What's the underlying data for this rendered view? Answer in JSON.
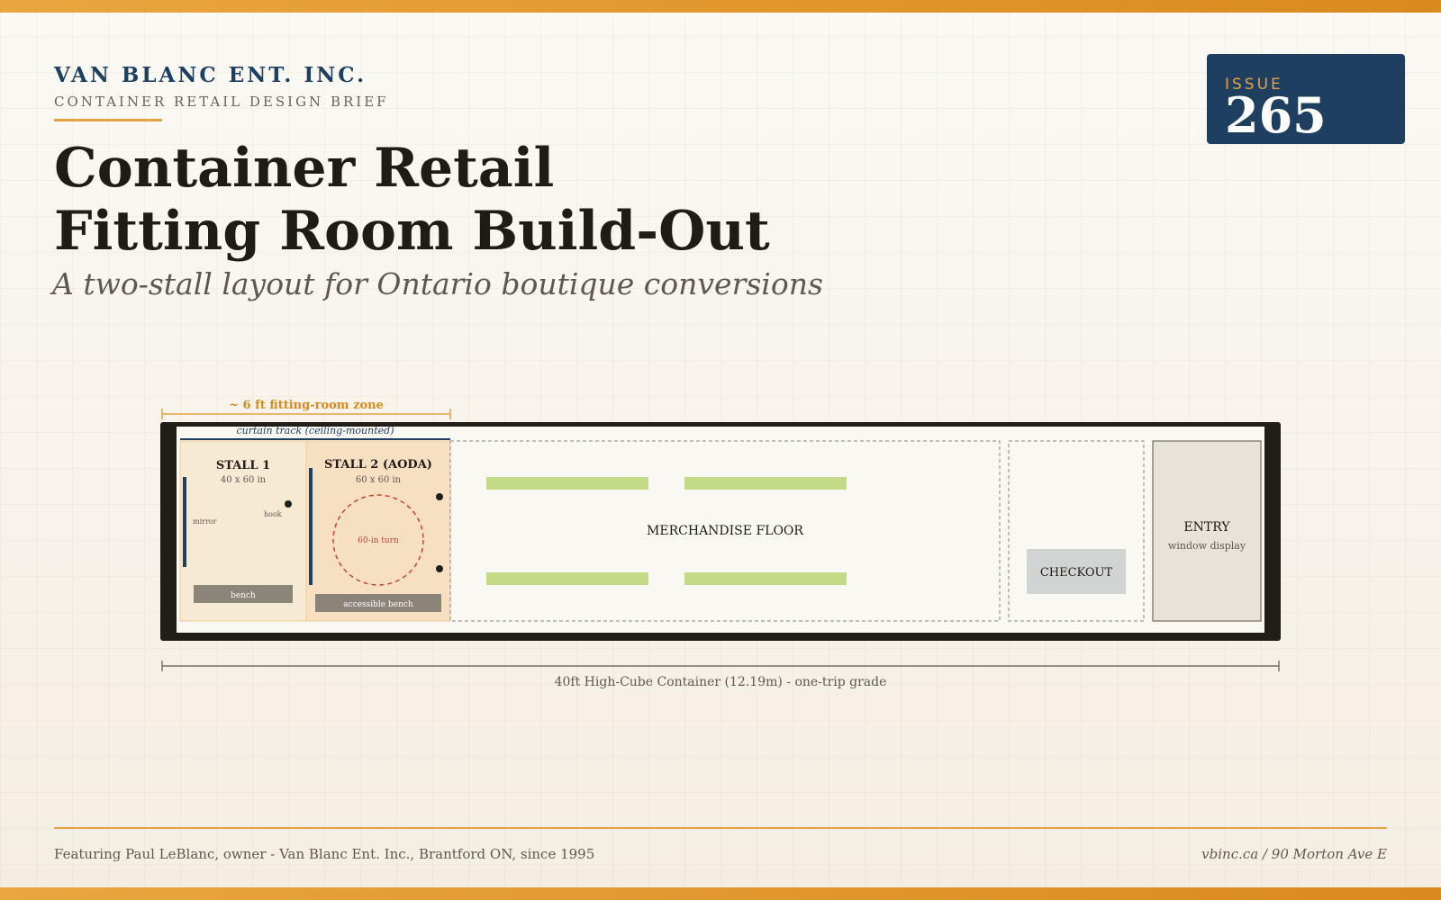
{
  "header": {
    "company": "VAN BLANC ENT. INC.",
    "brief": "CONTAINER RETAIL DESIGN BRIEF",
    "title_line1": "Container Retail",
    "title_line2": "Fitting Room Build-Out",
    "subtitle": "A two-stall layout for Ontario boutique conversions",
    "issue_label": "ISSUE",
    "issue_number": "265"
  },
  "floorplan": {
    "zone_label": "~ 6 ft fitting-room zone",
    "curtain_label": "curtain track (ceiling-mounted)",
    "stall1": {
      "title": "STALL 1",
      "dims": "40 x 60 in",
      "mirror": "mirror",
      "hook": "hook",
      "bench": "bench"
    },
    "stall2": {
      "title": "STALL 2 (AODA)",
      "dims": "60 x 60 in",
      "turn": "60-in turn",
      "bench": "accessible bench"
    },
    "merch": "MERCHANDISE FLOOR",
    "checkout": "CHECKOUT",
    "entry": "ENTRY",
    "entry_sub": "window display",
    "container_label": "40ft High-Cube Container (12.19m) - one-trip grade"
  },
  "footer": {
    "left": "Featuring Paul LeBlanc, owner - Van Blanc Ent. Inc., Brantford ON, since 1995",
    "right": "vbinc.ca / 90 Morton Ave E"
  },
  "colors": {
    "accent": "#e5a245",
    "navy": "#1f3f61",
    "rack": "#c2d985",
    "stall_fill": "#f7ead5",
    "stall2_fill": "#f7e0c2",
    "turn_circle": "#c4473a"
  }
}
